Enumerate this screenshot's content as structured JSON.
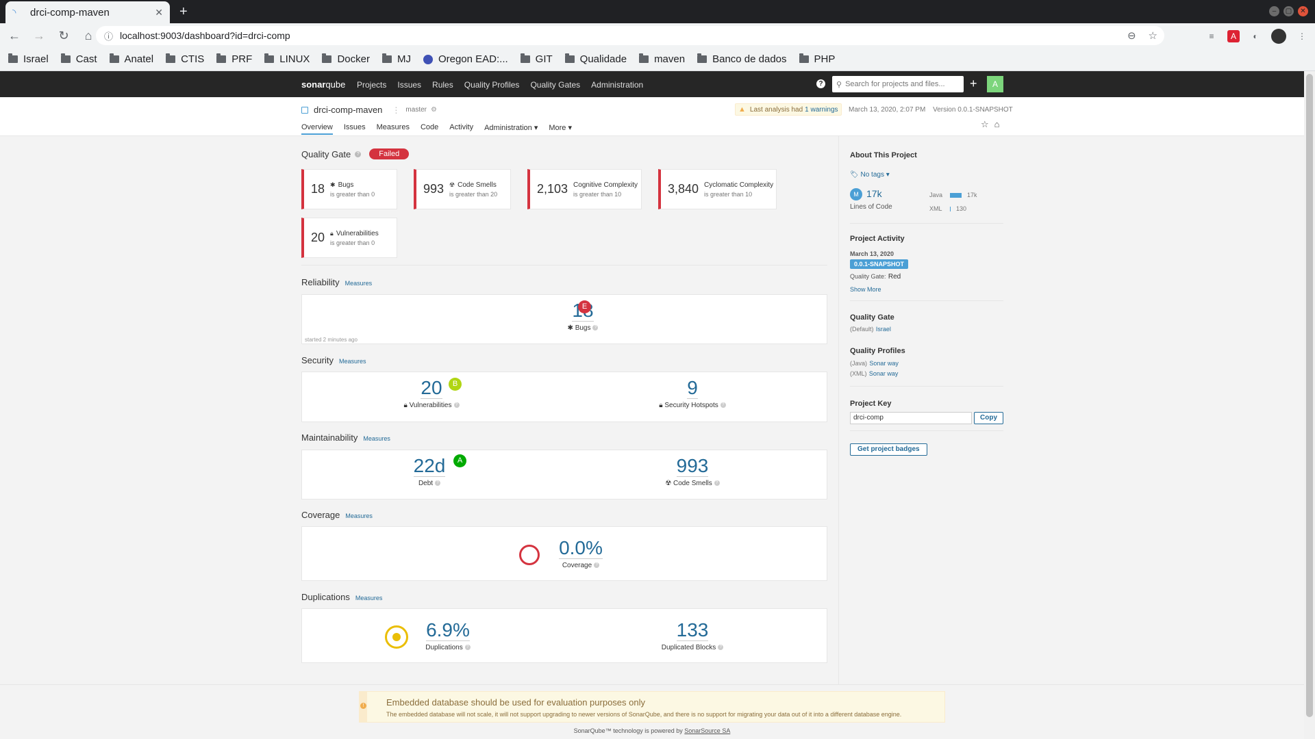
{
  "browser": {
    "tab_title": "drci-comp-maven",
    "url": "localhost:9003/dashboard?id=drci-comp",
    "bookmarks": [
      "Israel",
      "Cast",
      "Anatel",
      "CTIS",
      "PRF",
      "LINUX",
      "Docker",
      "MJ",
      "Oregon EAD:...",
      "GIT",
      "Qualidade",
      "maven",
      "Banco de dados",
      "PHP"
    ]
  },
  "nav": {
    "logo_a": "sonar",
    "logo_b": "qube",
    "links": [
      "Projects",
      "Issues",
      "Rules",
      "Quality Profiles",
      "Quality Gates",
      "Administration"
    ],
    "search_placeholder": "Search for projects and files...",
    "user_initial": "A"
  },
  "project": {
    "name": "drci-comp-maven",
    "branch": "master",
    "warning_text": "Last analysis had",
    "warning_link": "1 warnings",
    "date": "March 13, 2020, 2:07 PM",
    "version": "Version 0.0.1-SNAPSHOT",
    "tabs": [
      "Overview",
      "Issues",
      "Measures",
      "Code",
      "Activity",
      "Administration ▾",
      "More ▾"
    ]
  },
  "quality_gate": {
    "title": "Quality Gate",
    "status": "Failed",
    "conditions": [
      {
        "value": "18",
        "metric": "Bugs",
        "criterion": "is greater than 0"
      },
      {
        "value": "993",
        "metric": "Code Smells",
        "criterion": "is greater than 20"
      },
      {
        "value": "2,103",
        "metric": "Cognitive Complexity",
        "criterion": "is greater than 10"
      },
      {
        "value": "3,840",
        "metric": "Cyclomatic Complexity",
        "criterion": "is greater than 10"
      },
      {
        "value": "20",
        "metric": "Vulnerabilities",
        "criterion": "is greater than 0"
      }
    ]
  },
  "measures_link": "Measures",
  "reliability": {
    "title": "Reliability",
    "bugs": "18",
    "rating": "E",
    "bugs_label": "Bugs",
    "started": "started 2 minutes ago"
  },
  "security": {
    "title": "Security",
    "vulnerabilities": "20",
    "rating": "B",
    "vuln_label": "Vulnerabilities",
    "hotspots": "9",
    "hotspots_label": "Security Hotspots"
  },
  "maintainability": {
    "title": "Maintainability",
    "debt": "22d",
    "rating": "A",
    "debt_label": "Debt",
    "smells": "993",
    "smells_label": "Code Smells"
  },
  "coverage": {
    "title": "Coverage",
    "value": "0.0%",
    "label": "Coverage"
  },
  "duplications": {
    "title": "Duplications",
    "value": "6.9%",
    "label": "Duplications",
    "blocks": "133",
    "blocks_label": "Duplicated Blocks"
  },
  "sidebar": {
    "about_title": "About This Project",
    "tags": "No tags ▾",
    "loc_initial": "M",
    "loc": "17k",
    "loc_label": "Lines of Code",
    "languages": [
      {
        "name": "Java",
        "value": "17k"
      },
      {
        "name": "XML",
        "value": "130"
      }
    ],
    "activity_title": "Project Activity",
    "activity_date": "March 13, 2020",
    "activity_version": "0.0.1-SNAPSHOT",
    "activity_qg_label": "Quality Gate:",
    "activity_qg_value": "Red",
    "show_more": "Show More",
    "qg_title": "Quality Gate",
    "qg_default": "(Default)",
    "qg_name": "Israel",
    "qp_title": "Quality Profiles",
    "profiles": [
      {
        "lang": "(Java)",
        "name": "Sonar way"
      },
      {
        "lang": "(XML)",
        "name": "Sonar way"
      }
    ],
    "key_title": "Project Key",
    "key_value": "drci-comp",
    "copy_label": "Copy",
    "badges_label": "Get project badges"
  },
  "footer": {
    "warn_title": "Embedded database should be used for evaluation purposes only",
    "warn_text": "The embedded database will not scale, it will not support upgrading to newer versions of SonarQube, and there is no support for migrating your data out of it into a different database engine.",
    "powered_prefix": "SonarQube™ technology is powered by",
    "powered_link": "SonarSource SA"
  },
  "colors": {
    "failed": "#d4333f",
    "rating_e": "#d4333f",
    "rating_b": "#b0d513",
    "rating_a": "#00aa00",
    "accent": "#236a97",
    "nav_bg": "#262626"
  }
}
